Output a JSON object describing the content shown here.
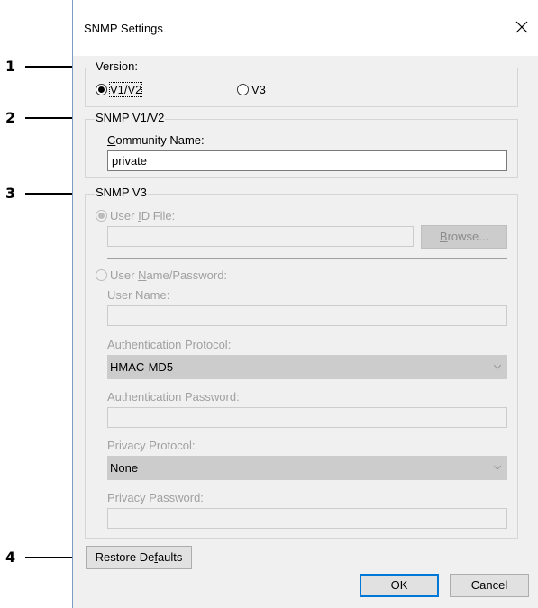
{
  "callouts": [
    "1",
    "2",
    "3",
    "4"
  ],
  "dialog": {
    "title": "SNMP Settings",
    "close_label": "×"
  },
  "version_group": {
    "legend": "Version:",
    "options": [
      {
        "label": "V1/V2",
        "checked": true
      },
      {
        "label": "V3",
        "checked": false
      }
    ]
  },
  "v1v2_group": {
    "legend": "SNMP V1/V2",
    "community_name_label_prefix": "",
    "community_name_label_u": "C",
    "community_name_label_rest": "ommunity Name:",
    "community_name_value": "private"
  },
  "v3_group": {
    "legend": "SNMP V3",
    "user_id_file_label_prefix": "User ",
    "user_id_file_label_u": "I",
    "user_id_file_label_rest": "D File:",
    "user_id_file_value": "",
    "browse_u": "B",
    "browse_rest": "rowse...",
    "user_name_password_label_prefix": "User ",
    "user_name_password_label_u": "N",
    "user_name_password_label_rest": "ame/Password:",
    "user_name_label": "User Name:",
    "user_name_value": "",
    "auth_protocol_label": "Authentication Protocol:",
    "auth_protocol_value": "HMAC-MD5",
    "auth_password_label": "Authentication Password:",
    "auth_password_value": "",
    "privacy_protocol_label": "Privacy Protocol:",
    "privacy_protocol_value": "None",
    "privacy_password_label": "Privacy Password:",
    "privacy_password_value": ""
  },
  "footer": {
    "restore_prefix": "Restore De",
    "restore_u": "f",
    "restore_rest": "aults",
    "ok_label": "OK",
    "cancel_label": "Cancel"
  }
}
